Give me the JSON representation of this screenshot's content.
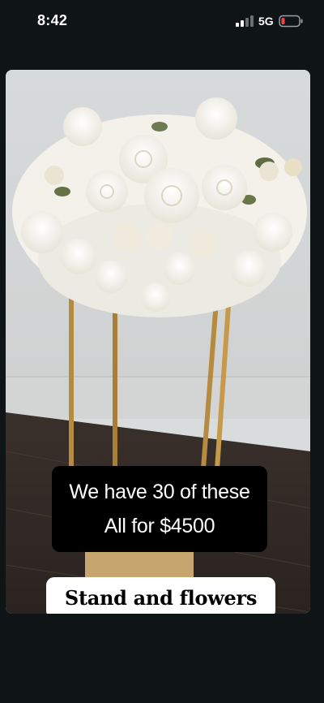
{
  "status_bar": {
    "time": "8:42",
    "network": "5G",
    "icons": [
      "signal-bars-icon",
      "battery-low-icon"
    ],
    "battery_color": "#e5484d"
  },
  "story": {
    "caption_line1": "We have 30 of these",
    "caption_line2": "All for $4500",
    "tag": "Stand and flowers"
  },
  "colors": {
    "background": "#0f1417",
    "caption_bg": "#000000",
    "tag_bg": "#ffffff",
    "stand_gold": "#c79a4b"
  }
}
